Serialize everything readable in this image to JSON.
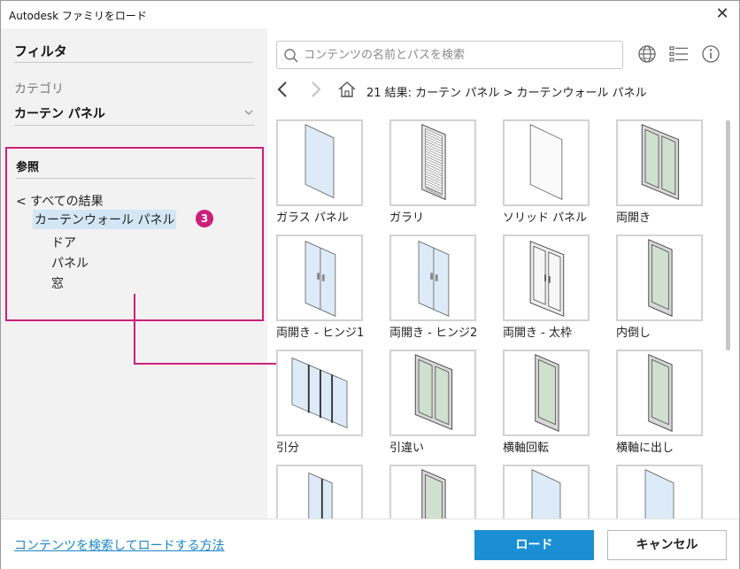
{
  "window": {
    "title": "Autodesk ファミリをロード",
    "close_glyph": "✕"
  },
  "sidebar": {
    "filter_title": "フィルタ",
    "category_label": "カテゴリ",
    "category_value": "カーテン パネル",
    "reference_title": "参照",
    "tree": {
      "all_results": "< すべての結果",
      "selected": "カーテンウォール パネル",
      "children": [
        "ドア",
        "パネル",
        "窓"
      ]
    },
    "badge": "3"
  },
  "search": {
    "placeholder": "コンテンツの名前とパスを検索",
    "value": ""
  },
  "toolbar_icons": [
    "globe-icon",
    "list-view-icon",
    "info-icon"
  ],
  "breadcrumb": "21 結果: カーテン パネル > カーテンウォール パネル",
  "items": [
    {
      "label": "ガラス パネル",
      "kind": "glass"
    },
    {
      "label": "ガラリ",
      "kind": "louver"
    },
    {
      "label": "ソリッド パネル",
      "kind": "solid"
    },
    {
      "label": "両開き",
      "kind": "double"
    },
    {
      "label": "両開き - ヒンジ1",
      "kind": "glassdoor"
    },
    {
      "label": "両開き - ヒンジ2",
      "kind": "glassdoor"
    },
    {
      "label": "両開き - 太枠",
      "kind": "frameddoor"
    },
    {
      "label": "内倒し",
      "kind": "single"
    },
    {
      "label": "引分",
      "kind": "sliding3"
    },
    {
      "label": "引違い",
      "kind": "double"
    },
    {
      "label": "横軸回転",
      "kind": "single"
    },
    {
      "label": "横軸に出し",
      "kind": "single"
    },
    {
      "label": "",
      "kind": "glassframe"
    },
    {
      "label": "",
      "kind": "single"
    },
    {
      "label": "",
      "kind": "glass"
    },
    {
      "label": "",
      "kind": "glass"
    }
  ],
  "footer": {
    "help_link": "コンテンツを検索してロードする方法",
    "load_button": "ロード",
    "cancel_button": "キャンセル"
  },
  "colors": {
    "accent": "#1b8fd3",
    "callout": "#cc1f7a",
    "glass": "#dcebf7",
    "frame_glass": "#cfe0cf"
  }
}
